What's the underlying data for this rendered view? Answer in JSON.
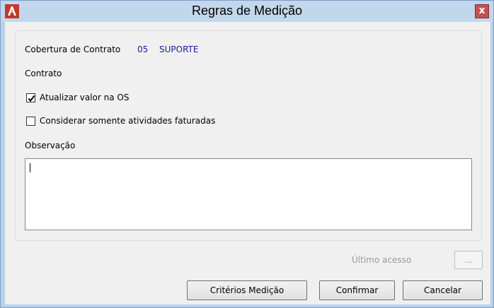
{
  "window": {
    "title": "Regras de Medição",
    "close_glyph": "x"
  },
  "form": {
    "cobertura_label": "Cobertura de Contrato",
    "cobertura_code": "05",
    "cobertura_name": "SUPORTE",
    "contrato_label": "Contrato",
    "chk_atualizar": {
      "label": "Atualizar valor na OS",
      "checked": true
    },
    "chk_considerar": {
      "label": "Considerar somente atividades faturadas",
      "checked": false
    },
    "observacao_label": "Observação",
    "observacao_value": ""
  },
  "footer": {
    "ultimo_acesso_label": "Último acesso",
    "ellipsis_label": "...",
    "buttons": {
      "criterios": "Critérios Medição",
      "confirmar": "Confirmar",
      "cancelar": "Cancelar"
    }
  },
  "colors": {
    "accent_blue": "#1a1aa0",
    "titlebar": "#c3d7ec",
    "close": "#c75050"
  }
}
